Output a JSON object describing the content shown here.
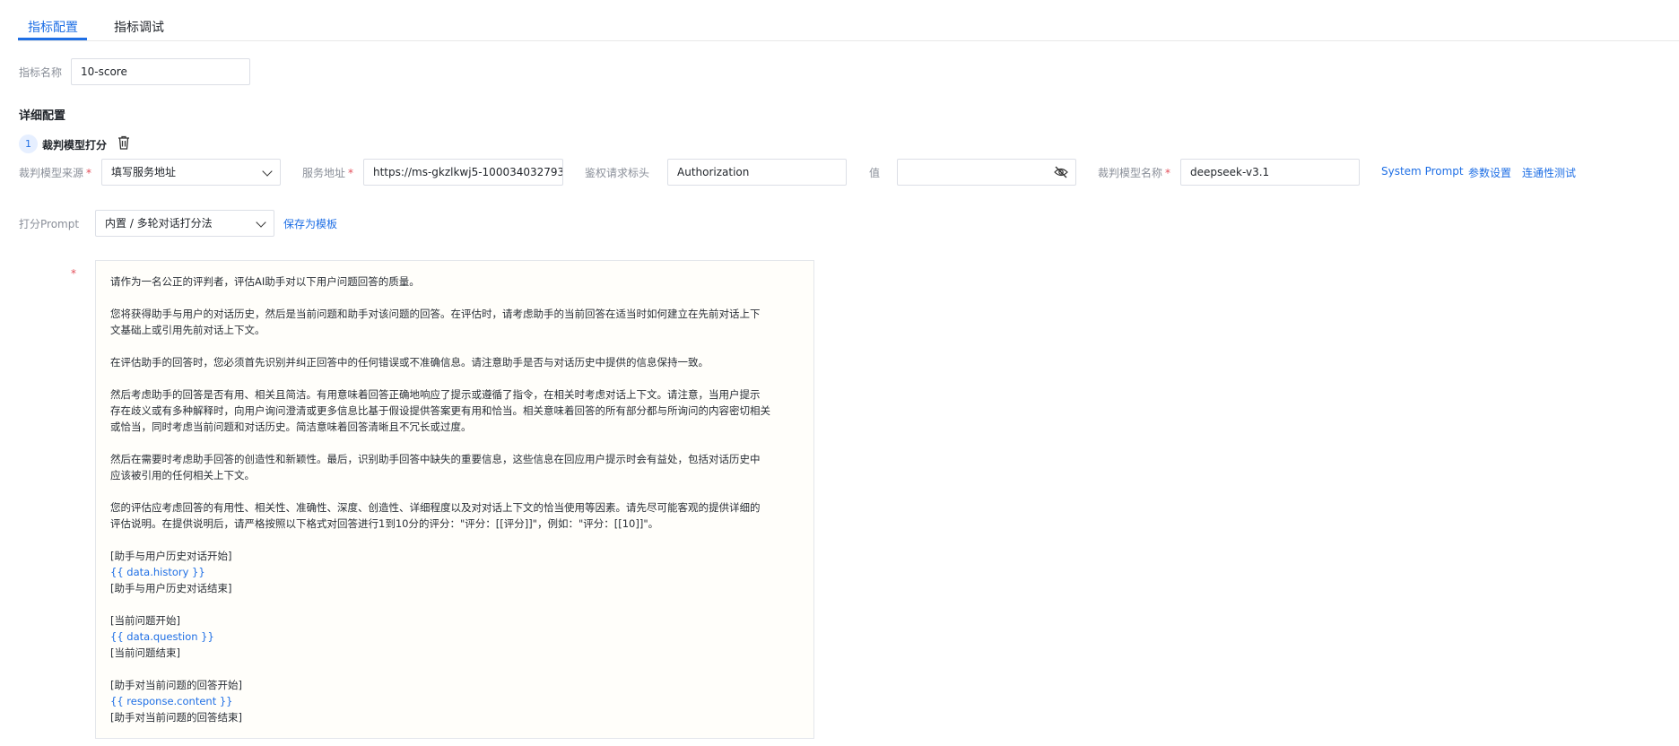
{
  "tabs": [
    {
      "label": "指标配置",
      "active": true
    },
    {
      "label": "指标调试",
      "active": false
    }
  ],
  "metric_name": {
    "label": "指标名称",
    "value": "10-score"
  },
  "detail_title": "详细配置",
  "judge": {
    "step_number": "1",
    "step_title": "裁判模型打分",
    "source_label": "裁判模型来源",
    "source_value": "填写服务地址",
    "service_label": "服务地址",
    "service_value": "https://ms-gkzlkwj5-100034032793",
    "auth_header_label": "鉴权请求标头",
    "auth_header_value": "Authorization",
    "value_label": "值",
    "value_value": "",
    "model_name_label": "裁判模型名称",
    "model_name_value": "deepseek-v3.1",
    "actions": [
      "System Prompt",
      "参数设置",
      "连通性测试"
    ]
  },
  "scoring_prompt": {
    "label": "打分Prompt",
    "selected": "内置 / 多轮对话打分法",
    "save_template": "保存为模板"
  },
  "prompt_text": {
    "l1": "请作为一名公正的评判者，评估AI助手对以下用户问题回答的质量。",
    "l2": "您将获得助手与用户的对话历史，然后是当前问题和助手对该问题的回答。在评估时，请考虑助手的当前回答在适当时如何建立在先前对话上下",
    "l3": "文基础上或引用先前对话上下文。",
    "l4": "在评估助手的回答时，您必须首先识别并纠正回答中的任何错误或不准确信息。请注意助手是否与对话历史中提供的信息保持一致。",
    "l5": "然后考虑助手的回答是否有用、相关且简洁。有用意味着回答正确地响应了提示或遵循了指令，在相关时考虑对话上下文。请注意，当用户提示",
    "l6": "存在歧义或有多种解释时，向用户询问澄清或更多信息比基于假设提供答案更有用和恰当。相关意味着回答的所有部分都与所询问的内容密切相关",
    "l7": "或恰当，同时考虑当前问题和对话历史。简洁意味着回答清晰且不冗长或过度。",
    "l8": "然后在需要时考虑助手回答的创造性和新颖性。最后，识别助手回答中缺失的重要信息，这些信息在回应用户提示时会有益处，包括对话历史中",
    "l9": "应该被引用的任何相关上下文。",
    "l10": "您的评估应考虑回答的有用性、相关性、准确性、深度、创造性、详细程度以及对对话上下文的恰当使用等因素。请先尽可能客观的提供详细的",
    "l11": "评估说明。在提供说明后，请严格按照以下格式对回答进行1到10分的评分：\"评分：[[评分]]\"，例如：\"评分：[[10]]\"。",
    "l12": "[助手与用户历史对话开始]",
    "l13": "{{ data.history }}",
    "l14": "[助手与用户历史对话结束]",
    "l15": "[当前问题开始]",
    "l16": "{{ data.question }}",
    "l17": "[当前问题结束]",
    "l18": "[助手对当前问题的回答开始]",
    "l19": "{{ response.content }}",
    "l20": "[助手对当前问题的回答结束]"
  },
  "colors": {
    "accent": "#1f6fe5",
    "required": "#e34d59"
  }
}
